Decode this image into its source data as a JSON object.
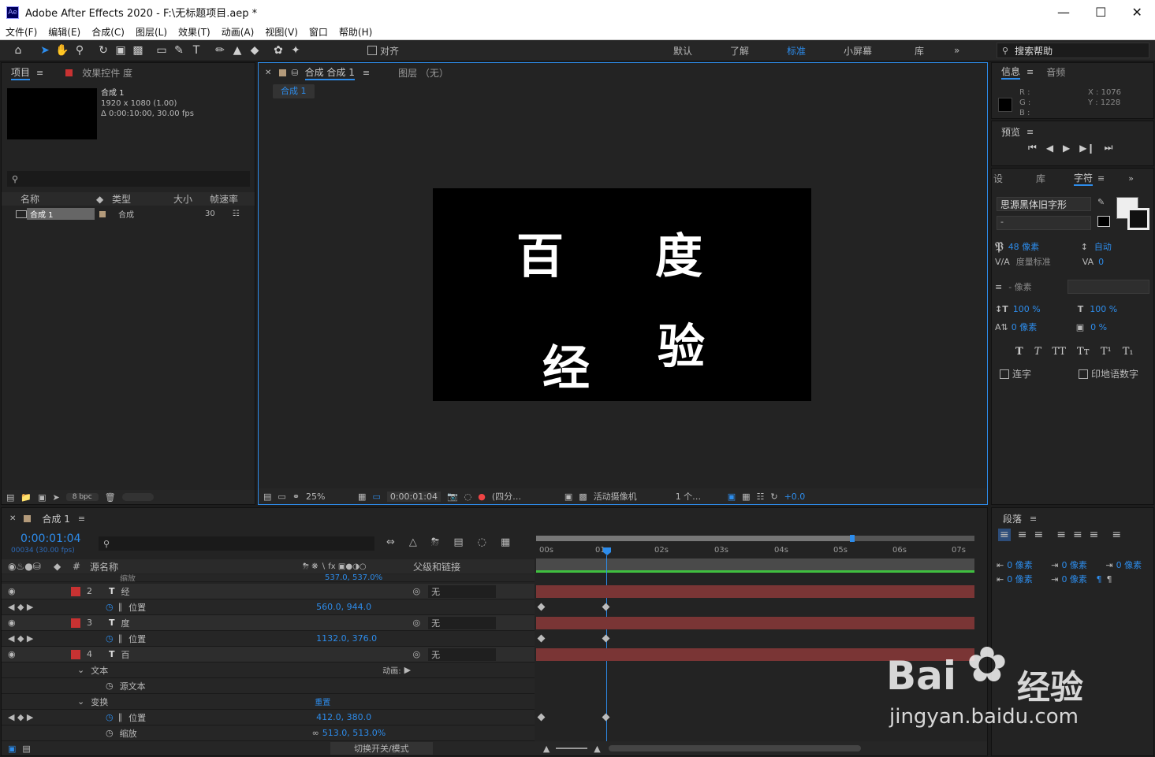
{
  "window": {
    "title": "Adobe After Effects 2020 - F:\\无标题项目.aep *",
    "app_icon": "Ae"
  },
  "menu": [
    "文件(F)",
    "编辑(E)",
    "合成(C)",
    "图层(L)",
    "效果(T)",
    "动画(A)",
    "视图(V)",
    "窗口",
    "帮助(H)"
  ],
  "toolbar": {
    "align_label": "对齐",
    "workspaces": [
      "默认",
      "了解",
      "标准",
      "小屏幕",
      "库"
    ],
    "active_workspace": "标准",
    "search_placeholder": "搜索帮助"
  },
  "project": {
    "tab": "项目",
    "effects_tab": "效果控件 度",
    "comp_name": "合成 1",
    "comp_size": "1920 x 1080 (1.00)",
    "comp_duration": "Δ 0:00:10:00, 30.00 fps",
    "search_placeholder": "",
    "columns": [
      "名称",
      "类型",
      "大小",
      "帧速率"
    ],
    "items": [
      {
        "name": "合成 1",
        "type": "合成",
        "fps": "30"
      }
    ],
    "bpc": "8 bpc"
  },
  "comp": {
    "tab": "合成 合成 1",
    "layer_tab": "图层 （无）",
    "sub_tab": "合成 1",
    "chars": [
      "百",
      "度",
      "经",
      "验"
    ],
    "zoom": "25%",
    "timecode": "0:00:01:04",
    "resolution": "(四分…",
    "camera": "活动摄像机",
    "views": "1 个…",
    "exposure": "+0.0"
  },
  "info": {
    "tab": "信息",
    "audio_tab": "音频",
    "rgb_labels": [
      "R :",
      "G :",
      "B :"
    ],
    "x": "X : 1076",
    "y": "Y : 1228"
  },
  "preview": {
    "tab": "预览"
  },
  "character": {
    "tabs": [
      "设",
      "库",
      "字符"
    ],
    "font": "思源黑体旧字形",
    "style": "-",
    "size": "48 像素",
    "leading": "自动",
    "kerning": "度量标准",
    "tracking": "0",
    "stroke": "- 像素",
    "vscale": "100 %",
    "hscale": "100 %",
    "baseline": "0 像素",
    "tsume": "0 %",
    "format_buttons": [
      "T",
      "T",
      "TT",
      "Tт",
      "T¹",
      "T₁"
    ],
    "ligature": "连字",
    "hindi": "印地语数字"
  },
  "paragraph": {
    "tab": "段落",
    "indent_values": [
      "0 像素",
      "0 像素",
      "0 像素",
      "0 像素",
      "0 像素"
    ]
  },
  "timeline": {
    "tab": "合成 1",
    "timecode": "0:00:01:04",
    "frame": "00034 (30.00 fps)",
    "col_source": "源名称",
    "col_parent": "父级和链接",
    "ruler": [
      "00s",
      "01s",
      "02s",
      "03s",
      "04s",
      "05s",
      "06s",
      "07s"
    ],
    "footer": "切换开关/模式",
    "rows": [
      {
        "kind": "prop",
        "name": "缩放",
        "value": "537.0, 537.0%"
      },
      {
        "kind": "layer",
        "num": "2",
        "name": "经",
        "parent": "无"
      },
      {
        "kind": "prop",
        "name": "位置",
        "value": "560.0, 944.0"
      },
      {
        "kind": "layer",
        "num": "3",
        "name": "度",
        "parent": "无"
      },
      {
        "kind": "prop",
        "name": "位置",
        "value": "1132.0, 376.0"
      },
      {
        "kind": "layer",
        "num": "4",
        "name": "百",
        "parent": "无"
      },
      {
        "kind": "group",
        "name": "文本",
        "extra": "动画:"
      },
      {
        "kind": "sub",
        "name": "源文本"
      },
      {
        "kind": "group",
        "name": "变换",
        "extra": "重置"
      },
      {
        "kind": "prop",
        "name": "位置",
        "value": "412.0, 380.0"
      },
      {
        "kind": "sub",
        "name": "缩放",
        "value": "513.0, 513.0%"
      }
    ]
  },
  "watermark": {
    "brand": "Bai",
    "brand2": "经验",
    "url": "jingyan.baidu.com"
  },
  "colors": {
    "accent": "#2d8ceb",
    "label_red": "#c83232",
    "track": "#7a3535",
    "work_green": "#3fbf3f"
  }
}
